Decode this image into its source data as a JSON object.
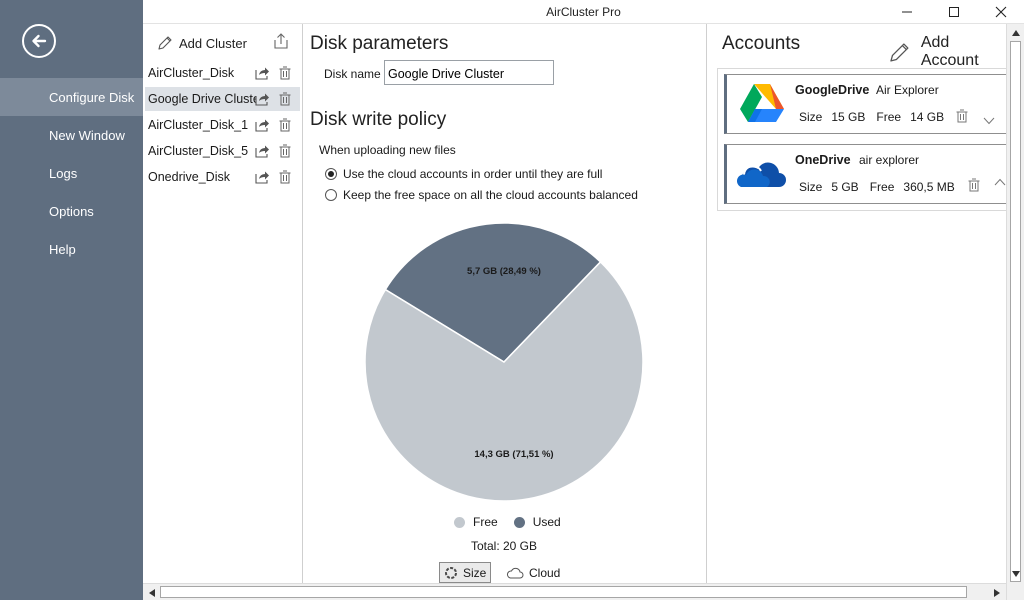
{
  "window": {
    "title": "AirCluster Pro"
  },
  "sidebar": {
    "items": [
      {
        "label": "Configure Disk",
        "active": true
      },
      {
        "label": "New Window"
      },
      {
        "label": "Logs"
      },
      {
        "label": "Options"
      },
      {
        "label": "Help"
      }
    ]
  },
  "clusters": {
    "add_label": "Add Cluster",
    "items": [
      {
        "name": "AirCluster_Disk"
      },
      {
        "name": "Google Drive Cluster",
        "selected": true
      },
      {
        "name": "AirCluster_Disk_1"
      },
      {
        "name": "AirCluster_Disk_5"
      },
      {
        "name": "Onedrive_Disk"
      }
    ]
  },
  "disk": {
    "heading": "Disk parameters",
    "name_label": "Disk name",
    "name_value": "Google Drive Cluster",
    "policy_heading": "Disk write policy",
    "policy_sub": "When uploading new files",
    "options": [
      {
        "label": "Use the cloud accounts in order until they are full",
        "checked": true
      },
      {
        "label": "Keep the free space on all the cloud accounts balanced",
        "checked": false
      }
    ]
  },
  "chart_data": {
    "type": "pie",
    "slices": [
      {
        "name": "Used",
        "value": 28.49,
        "label": "5,7 GB (28,49 %)",
        "color": "#627183"
      },
      {
        "name": "Free",
        "value": 71.51,
        "label": "14,3 GB (71,51 %)",
        "color": "#c2c8ce"
      }
    ],
    "legend": [
      "Free",
      "Used"
    ],
    "total_label": "Total: 20 GB"
  },
  "view_toggle": {
    "size_label": "Size",
    "cloud_label": "Cloud",
    "selected": "Size"
  },
  "accounts": {
    "heading": "Accounts",
    "add_label": "Add Account",
    "items": [
      {
        "service": "GoogleDrive",
        "user": "Air Explorer",
        "size_label": "Size",
        "size": "15 GB",
        "free_label": "Free",
        "free": "14 GB"
      },
      {
        "service": "OneDrive",
        "user": "air explorer",
        "size_label": "Size",
        "size": "5 GB",
        "free_label": "Free",
        "free": "360,5 MB"
      }
    ]
  },
  "colors": {
    "sidebar": "#5f6e80",
    "sidebar_active": "#7d8a9a",
    "used": "#627183",
    "free": "#c2c8ce"
  }
}
